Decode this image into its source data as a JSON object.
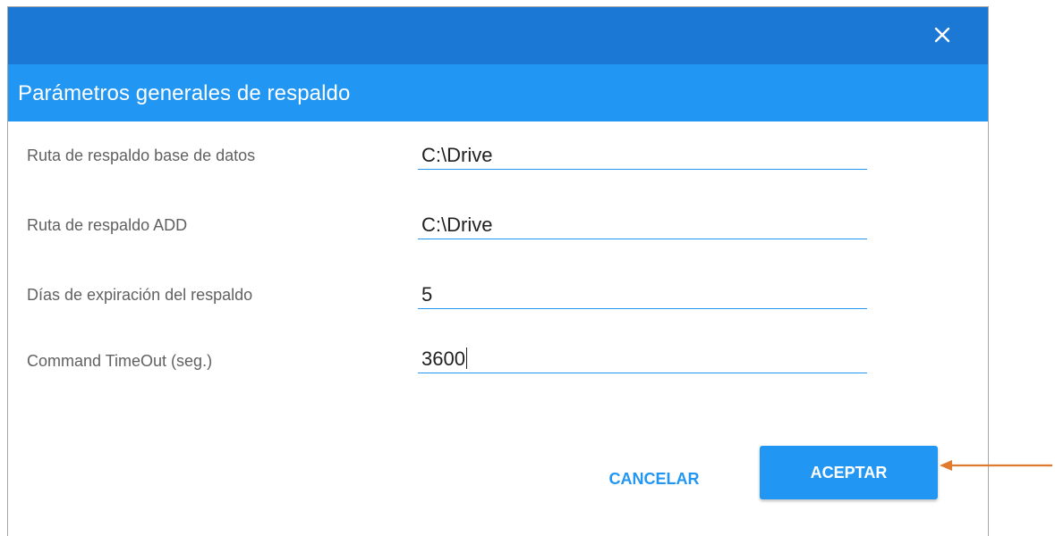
{
  "dialog": {
    "close_icon": "close-icon",
    "title": "Parámetros generales de respaldo",
    "colors": {
      "titlebar": "#1b78d5",
      "header": "#2196f3",
      "accent": "#2196f3",
      "annotation_arrow": "#e07a2e"
    }
  },
  "fields": [
    {
      "label": "Ruta de respaldo base de datos",
      "value": "C:\\Drive"
    },
    {
      "label": "Ruta de respaldo ADD",
      "value": "C:\\Drive"
    },
    {
      "label": "Días de expiración del respaldo",
      "value": "5"
    },
    {
      "label": "Command TimeOut (seg.)",
      "value": "3600"
    }
  ],
  "buttons": {
    "cancel_label": "CANCELAR",
    "accept_label": "ACEPTAR"
  },
  "annotation": {
    "arrow_icon": "arrow-left-icon"
  }
}
